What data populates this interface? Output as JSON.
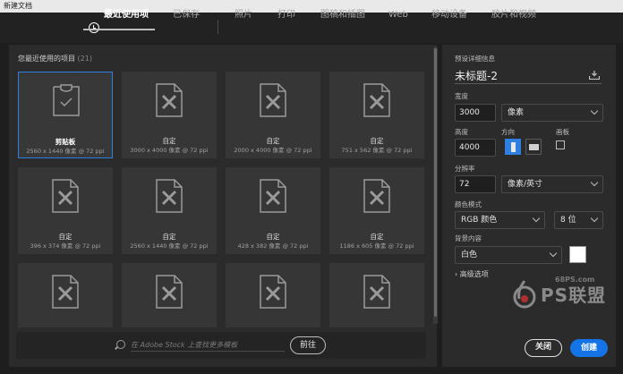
{
  "window": {
    "title": "新建文档"
  },
  "tabs": [
    {
      "label": "最近使用项",
      "active": true
    },
    {
      "label": "已保存",
      "active": false
    },
    {
      "label": "照片",
      "active": false
    },
    {
      "label": "打印",
      "active": false
    },
    {
      "label": "图稿和插图",
      "active": false
    },
    {
      "label": "Web",
      "active": false
    },
    {
      "label": "移动设备",
      "active": false
    },
    {
      "label": "胶片和视频",
      "active": false
    }
  ],
  "recent": {
    "label": "您最近使用的项目",
    "count": "(21)",
    "items": [
      {
        "name": "剪贴板",
        "size": "2560 x 1440 像素 @ 72 ppi",
        "selected": true,
        "icon": "clipboard-check-icon"
      },
      {
        "name": "自定",
        "size": "3000 x 4000 像素 @ 72 ppi",
        "icon": "custom-document-icon"
      },
      {
        "name": "自定",
        "size": "2000 x 4000 像素 @ 72 ppi",
        "icon": "custom-document-icon"
      },
      {
        "name": "自定",
        "size": "751 x 562 像素 @ 72 ppi",
        "icon": "custom-document-icon"
      },
      {
        "name": "自定",
        "size": "396 x 374 像素 @ 72 ppi",
        "icon": "custom-document-icon"
      },
      {
        "name": "自定",
        "size": "2560 x 1440 像素 @ 72 ppi",
        "icon": "custom-document-icon"
      },
      {
        "name": "自定",
        "size": "428 x 382 像素 @ 72 ppi",
        "icon": "custom-document-icon"
      },
      {
        "name": "自定",
        "size": "1186 x 605 像素 @ 72 ppi",
        "icon": "custom-document-icon"
      },
      {
        "name": "",
        "size": "",
        "icon": "custom-document-icon"
      },
      {
        "name": "",
        "size": "",
        "icon": "custom-document-icon"
      },
      {
        "name": "",
        "size": "",
        "icon": "custom-document-icon"
      },
      {
        "name": "",
        "size": "",
        "icon": "custom-document-icon"
      }
    ]
  },
  "stock_search": {
    "placeholder": "在 Adobe Stock 上查找更多模板",
    "go_label": "前往"
  },
  "details": {
    "header": "预设详细信息",
    "doc_name": "未标题-2",
    "width_label": "宽度",
    "width_value": "3000",
    "width_unit": "像素",
    "height_label": "高度",
    "height_value": "4000",
    "orientation_label": "方向",
    "orientation": "portrait",
    "artboard_label": "画板",
    "artboard_checked": false,
    "resolution_label": "分辨率",
    "resolution_value": "72",
    "resolution_unit": "像素/英寸",
    "color_mode_label": "颜色模式",
    "color_mode": "RGB 颜色",
    "bit_depth": "8 位",
    "background_label": "背景内容",
    "background": "白色",
    "background_color": "#ffffff",
    "advanced_label": "高级选项"
  },
  "buttons": {
    "close": "关闭",
    "create": "创建"
  },
  "watermark": {
    "site": "68PS.com",
    "brand": "PS联盟"
  },
  "colors": {
    "accent": "#1473e6",
    "selection": "#2d7fe0",
    "panel": "#2b2b2b"
  }
}
